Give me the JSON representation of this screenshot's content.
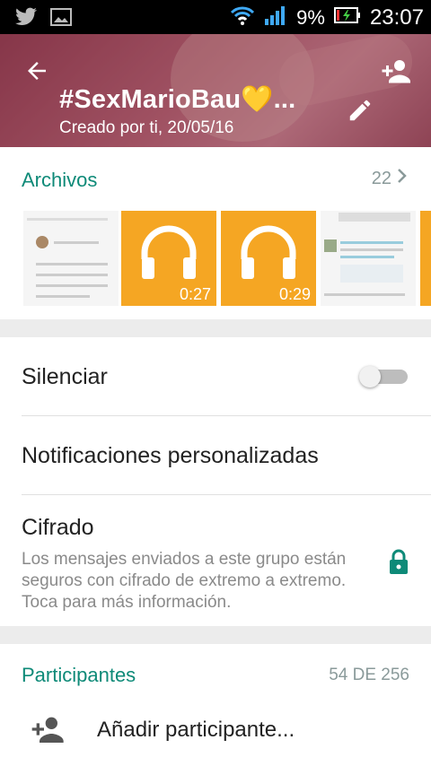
{
  "status_bar": {
    "battery_percent": "9%",
    "time": "23:07",
    "icons": [
      "twitter-icon",
      "image-icon",
      "wifi-icon",
      "signal-icon",
      "battery-charging-icon"
    ]
  },
  "header": {
    "title": "#SexMarioBau💛...",
    "subtitle": "Creado por ti, 20/05/16",
    "icons": [
      "back-arrow-icon",
      "add-person-icon",
      "edit-pencil-icon"
    ]
  },
  "files": {
    "label": "Archivos",
    "count": "22",
    "thumbnails": [
      {
        "type": "screenshot"
      },
      {
        "type": "audio",
        "duration": "0:27"
      },
      {
        "type": "audio",
        "duration": "0:29"
      },
      {
        "type": "screenshot"
      }
    ]
  },
  "settings": {
    "mute_label": "Silenciar",
    "mute_on": false,
    "notifications_label": "Notificaciones personalizadas",
    "encryption_label": "Cifrado",
    "encryption_description": "Los mensajes enviados a este grupo están seguros con cifrado de extremo a extremo. Toca para más información."
  },
  "participants": {
    "label": "Participantes",
    "count": "54 DE 256",
    "add_label": "Añadir participante..."
  },
  "colors": {
    "accent": "#0e8a78",
    "audio_thumb": "#f5a623",
    "lock": "#0e8a78"
  }
}
